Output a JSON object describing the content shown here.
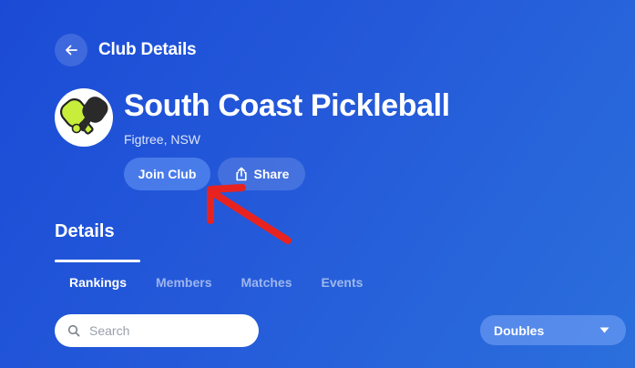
{
  "header": {
    "title": "Club Details",
    "back_icon": "arrow-left-icon"
  },
  "club": {
    "name": "South Coast Pickleball",
    "location": "Figtree, NSW",
    "logo_icon": "pickleball-paddles-icon"
  },
  "actions": {
    "join_label": "Join Club",
    "share_label": "Share",
    "share_icon": "share-icon"
  },
  "details": {
    "title": "Details",
    "tabs": [
      {
        "label": "Rankings",
        "active": true
      },
      {
        "label": "Members",
        "active": false
      },
      {
        "label": "Matches",
        "active": false
      },
      {
        "label": "Events",
        "active": false
      }
    ]
  },
  "search": {
    "placeholder": "Search",
    "icon": "search-icon"
  },
  "filter": {
    "selected": "Doubles",
    "icon": "caret-down-icon"
  },
  "colors": {
    "arrow": "#e8231f",
    "join_button": "#5b8ff0"
  }
}
